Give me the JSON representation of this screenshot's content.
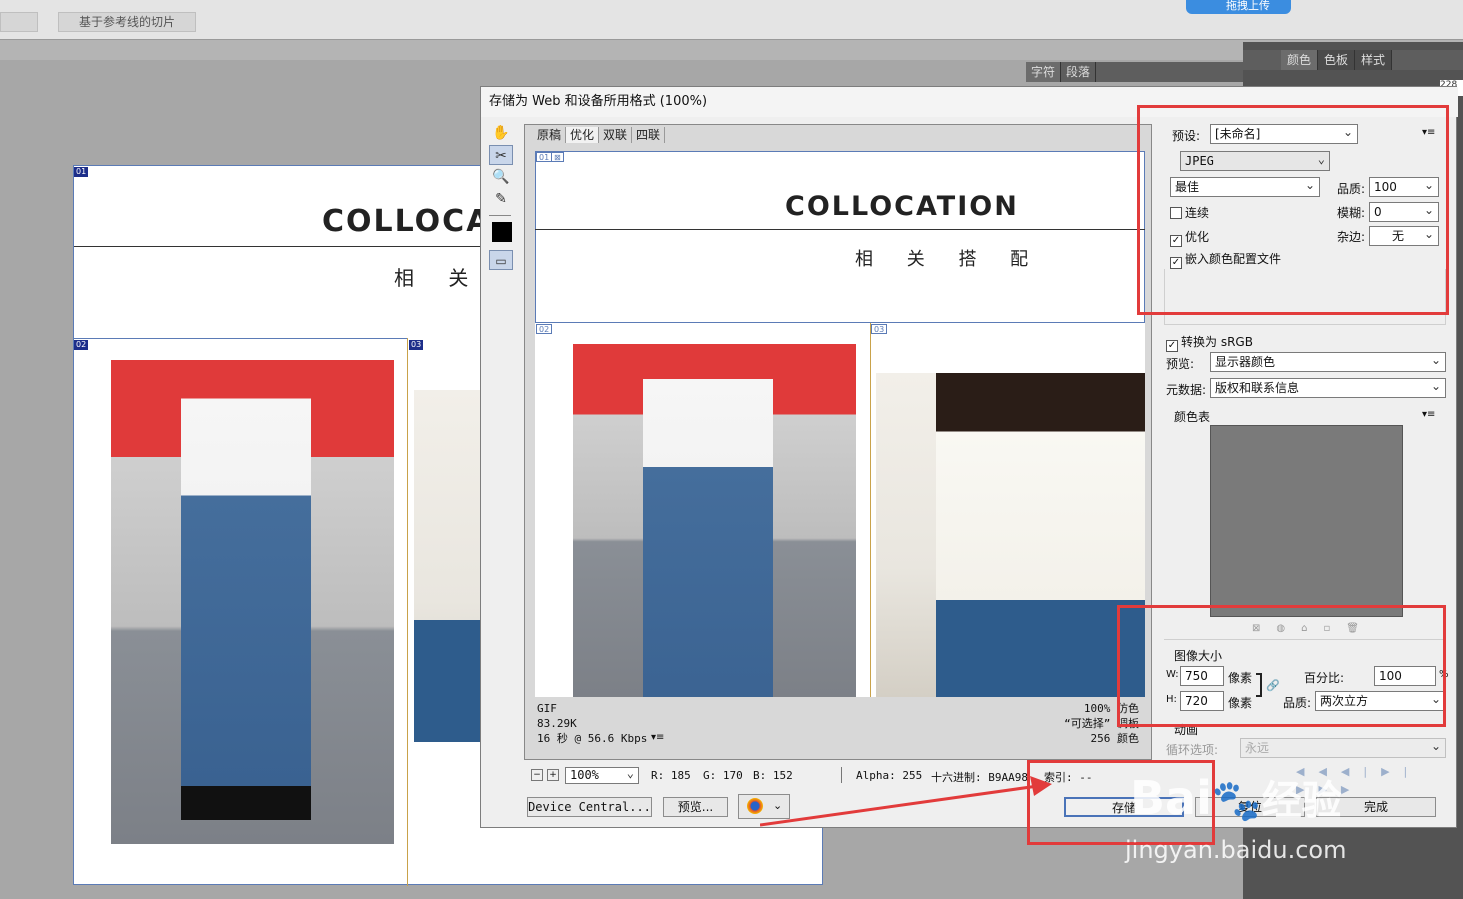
{
  "app": {
    "toolbar_slice_label": "基于参考线的切片",
    "upload_label": "拖拽上传"
  },
  "ps_panels": {
    "char_tabs": [
      "字符",
      "段落"
    ],
    "color_tabs": [
      "颜色",
      "色板",
      "样式"
    ],
    "partial_value": "228"
  },
  "canvas": {
    "brand": "COLLOCA",
    "subtitle": "相 关 搭",
    "slices": [
      "01",
      "02",
      "03"
    ]
  },
  "dialog": {
    "title": "存储为 Web 和设备所用格式 (100%)",
    "tabs": [
      "原稿",
      "优化",
      "双联",
      "四联"
    ],
    "active_tab": "优化",
    "preview": {
      "brand": "COLLOCATION",
      "subtitle": "相 关 搭 配",
      "slices": [
        "01",
        "02",
        "03"
      ],
      "info_left": [
        "GIF",
        "83.29K",
        "16 秒 @ 56.6 Kbps"
      ],
      "info_right": [
        "100% 仿色",
        "“可选择” 调板",
        "256 颜色"
      ]
    },
    "status": {
      "zoom": "100%",
      "r": "R: 185",
      "g": "G: 170",
      "b": "B: 152",
      "alpha": "Alpha: 255",
      "hex": "十六进制: B9AA98",
      "index": "索引: --"
    },
    "buttons": {
      "device_central": "Device Central...",
      "preview": "预览...",
      "save": "存储",
      "reset": "复位",
      "done": "完成"
    },
    "settings": {
      "preset_label": "预设:",
      "preset_value": "[未命名]",
      "format": "JPEG",
      "quality_preset": "最佳",
      "quality_label": "品质:",
      "quality_value": "100",
      "progressive": "连续",
      "blur_label": "模糊:",
      "blur_value": "0",
      "optimized": "优化",
      "matte_label": "杂边:",
      "matte_value": "无",
      "embed_profile": "嵌入颜色配置文件",
      "convert_srgb": "转换为 sRGB",
      "preview_label": "预览:",
      "preview_value": "显示器颜色",
      "metadata_label": "元数据:",
      "metadata_value": "版权和联系信息",
      "color_table_label": "颜色表",
      "image_size_label": "图像大小",
      "w_label": "W:",
      "w_value": "750",
      "h_label": "H:",
      "h_value": "720",
      "px_unit": "像素",
      "percent_label": "百分比:",
      "percent_value": "100",
      "percent_unit": "%",
      "resample_label": "品质:",
      "resample_value": "两次立方",
      "animation_label": "动画",
      "loop_label": "循环选项:",
      "loop_value": "永远"
    }
  },
  "watermark": {
    "brand": "Bai",
    "brand2": "经验",
    "url": "jingyan.baidu.com"
  },
  "colors": {
    "annotation_red": "#e23b3b",
    "slice_blue": "#1d2e8a",
    "color_table_gray": "#7a7a7a"
  }
}
